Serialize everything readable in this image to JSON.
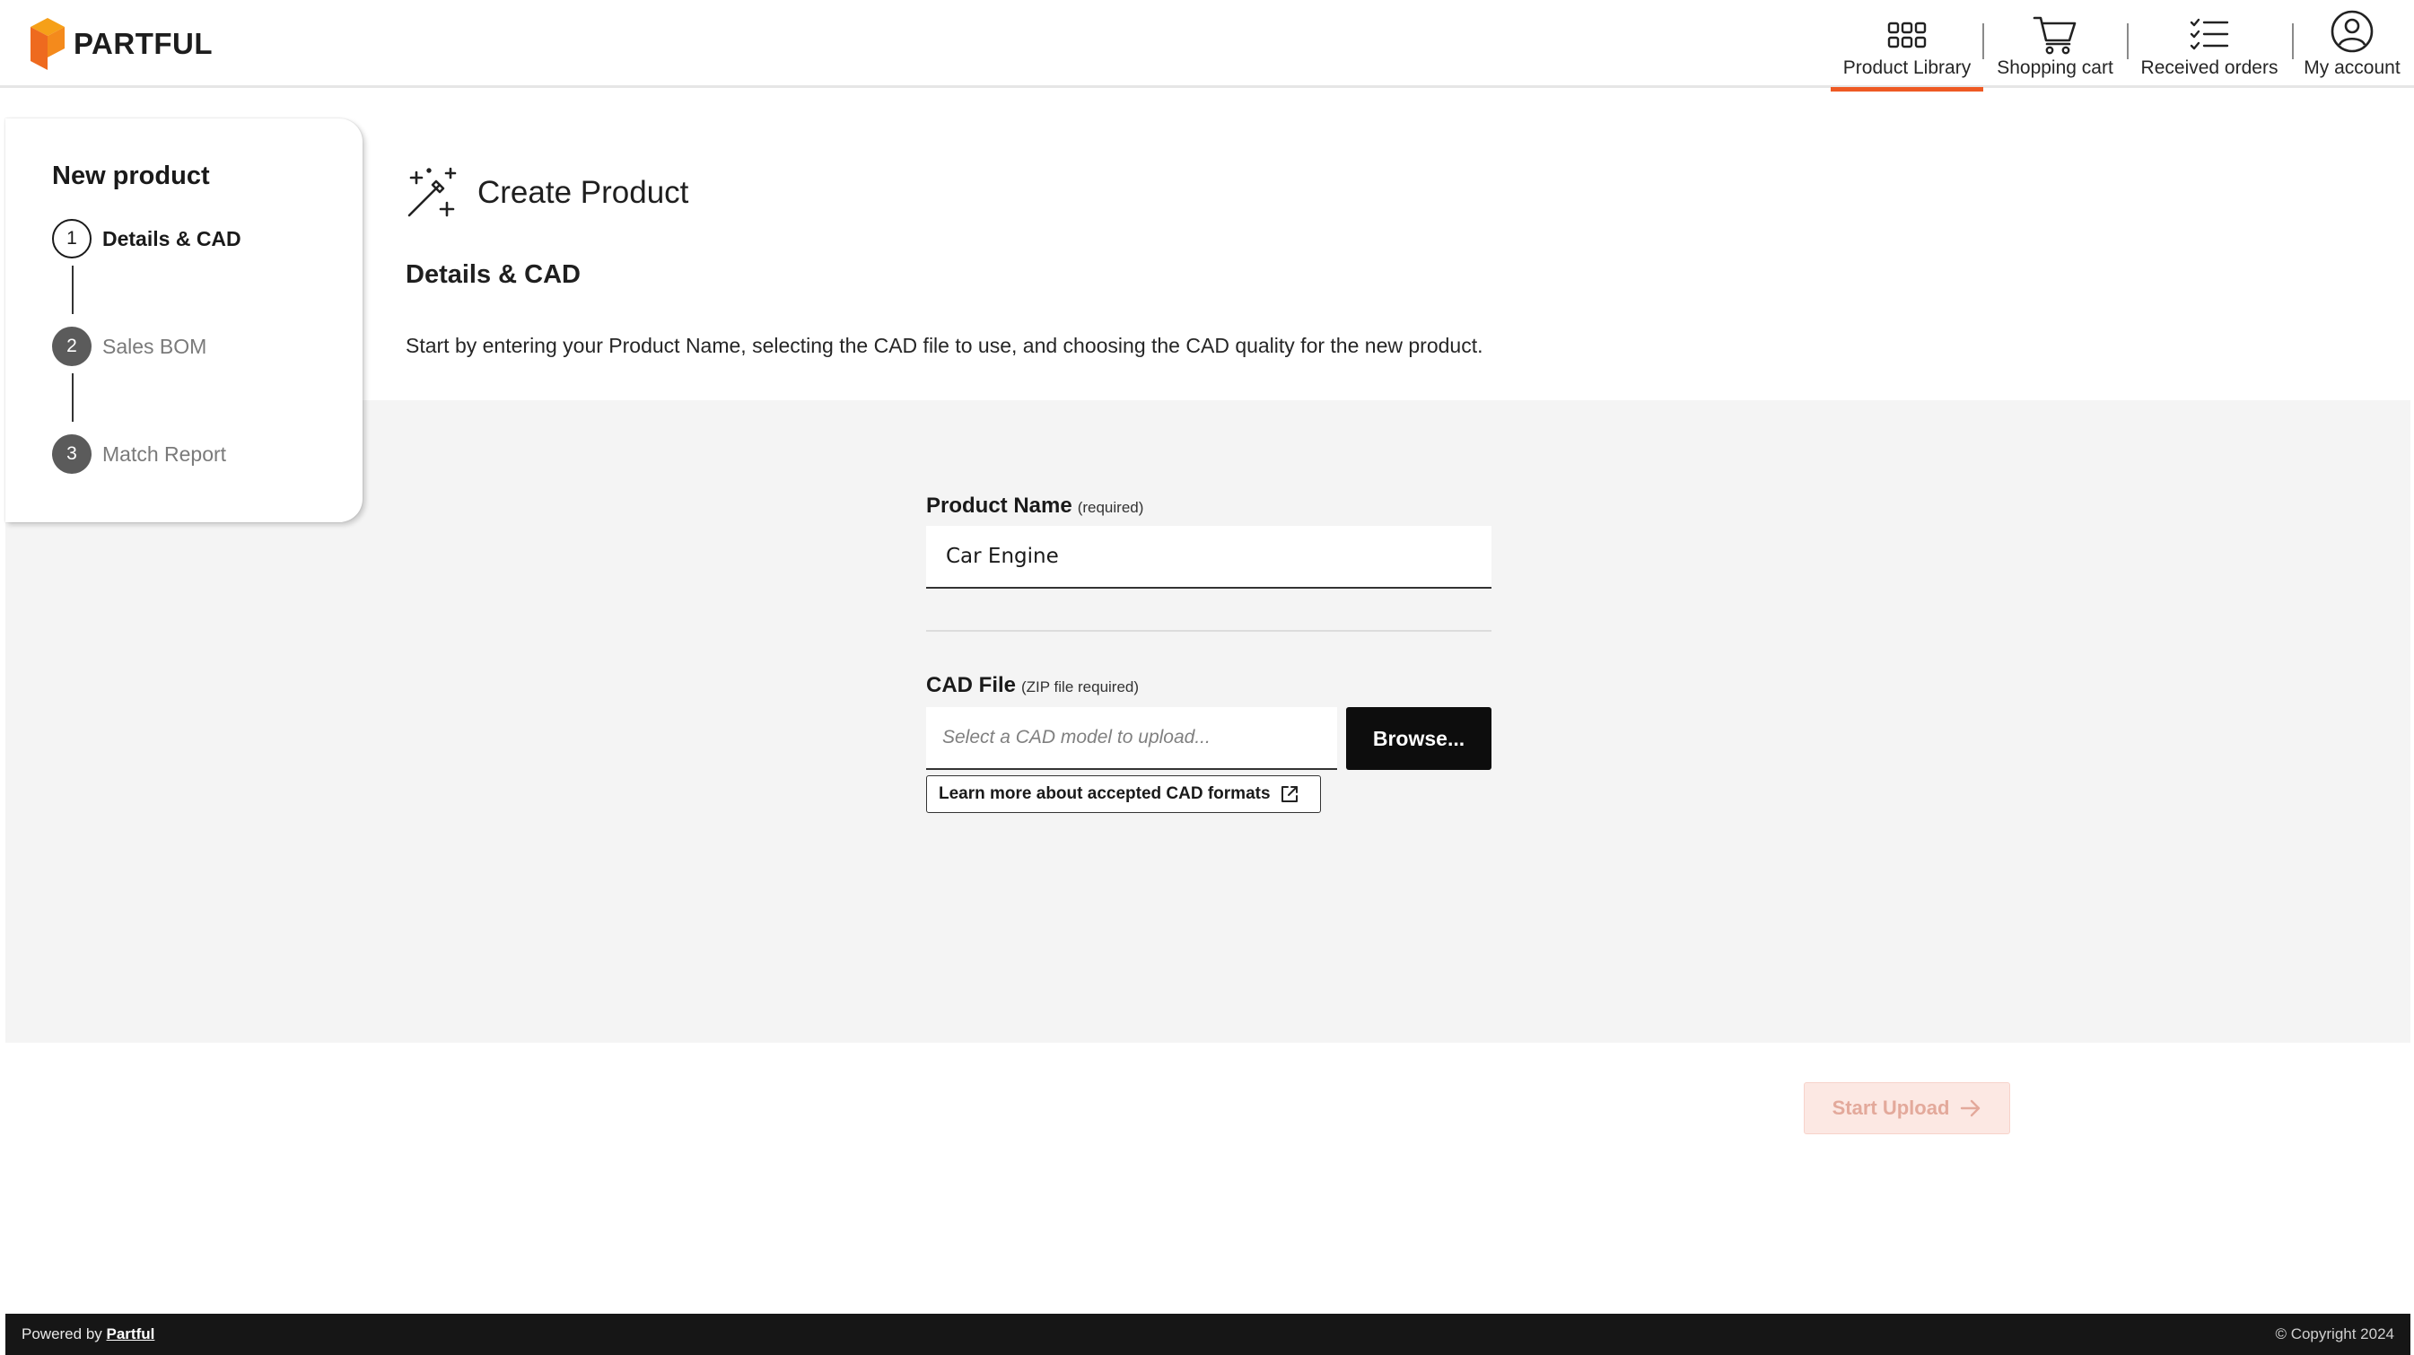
{
  "brand": {
    "name": "PARTFUL",
    "accent_color": "#ee5a24"
  },
  "nav": {
    "items": [
      {
        "label": "Product Library",
        "icon": "grid-icon",
        "active": true
      },
      {
        "label": "Shopping cart",
        "icon": "cart-icon",
        "active": false
      },
      {
        "label": "Received orders",
        "icon": "checklist-icon",
        "active": false
      },
      {
        "label": "My account",
        "icon": "user-circle-icon",
        "active": false
      }
    ]
  },
  "sidebar": {
    "title": "New product",
    "steps": [
      {
        "number": "1",
        "label": "Details & CAD",
        "state": "current"
      },
      {
        "number": "2",
        "label": "Sales BOM",
        "state": "pending"
      },
      {
        "number": "3",
        "label": "Match Report",
        "state": "pending"
      }
    ]
  },
  "main": {
    "title": "Create Product",
    "section_title": "Details & CAD",
    "intro": "Start by entering your Product Name, selecting the CAD file to use, and choosing the CAD quality for the new product."
  },
  "form": {
    "product_name": {
      "label": "Product Name",
      "hint": "(required)",
      "value": "Car Engine"
    },
    "cad_file": {
      "label": "CAD File",
      "hint": "(ZIP file required)",
      "placeholder": "Select a CAD model to upload...",
      "browse_label": "Browse..."
    },
    "learn_more_label": "Learn more about accepted CAD formats"
  },
  "actions": {
    "start_upload_label": "Start Upload",
    "start_upload_enabled": false
  },
  "footer": {
    "powered_by": "Powered by",
    "powered_by_link": "Partful",
    "copyright": "© Copyright 2024"
  }
}
